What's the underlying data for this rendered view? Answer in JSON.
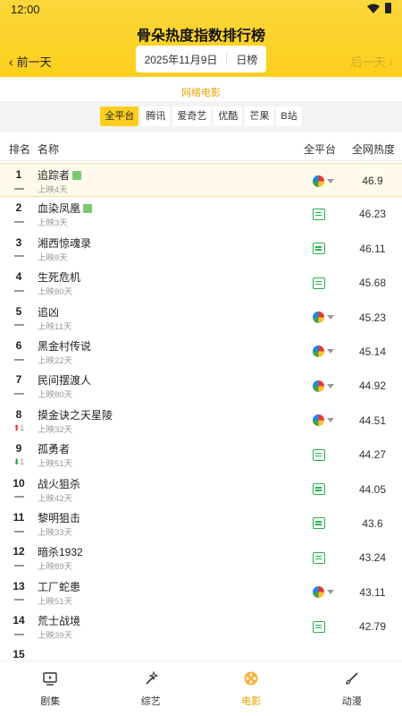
{
  "status": {
    "time": "12:00"
  },
  "header": {
    "title": "骨朵热度指数排行榜",
    "prev_label": "前一天",
    "next_label": "后一天",
    "date": "2025年11月9日",
    "period": "日榜"
  },
  "subtitle": "网络电影",
  "platforms": [
    "全平台",
    "腾讯",
    "爱奇艺",
    "优酷",
    "芒果",
    "B站"
  ],
  "columns": {
    "rank": "排名",
    "name": "名称",
    "platform": "全平台",
    "heat": "全网热度"
  },
  "rows": [
    {
      "rank": "1",
      "trend": "",
      "title": "追踪者",
      "badge": true,
      "days": "上映4天",
      "platform": "multi",
      "heat": "46.9"
    },
    {
      "rank": "2",
      "trend": "",
      "title": "血染凤凰",
      "badge": true,
      "days": "上映3天",
      "platform": "iqiyi",
      "heat": "46.23"
    },
    {
      "rank": "3",
      "trend": "",
      "title": "湘西惊魂录",
      "badge": false,
      "days": "上映8天",
      "platform": "iqiyi",
      "heat": "46.11"
    },
    {
      "rank": "4",
      "trend": "",
      "title": "生死危机",
      "badge": false,
      "days": "上映80天",
      "platform": "iqiyi",
      "heat": "45.68"
    },
    {
      "rank": "5",
      "trend": "",
      "title": "追凶",
      "badge": false,
      "days": "上映11天",
      "platform": "multi",
      "heat": "45.23"
    },
    {
      "rank": "6",
      "trend": "",
      "title": "黑金村传说",
      "badge": false,
      "days": "上映22天",
      "platform": "multi",
      "heat": "45.14"
    },
    {
      "rank": "7",
      "trend": "",
      "title": "民间摆渡人",
      "badge": false,
      "days": "上映80天",
      "platform": "multi",
      "heat": "44.92"
    },
    {
      "rank": "8",
      "trend": "up",
      "trend_value": "1",
      "title": "摸金诀之天星陵",
      "badge": false,
      "days": "上映32天",
      "platform": "multi",
      "heat": "44.51"
    },
    {
      "rank": "9",
      "trend": "down",
      "trend_value": "1",
      "title": "孤勇者",
      "badge": false,
      "days": "上映51天",
      "platform": "iqiyi",
      "heat": "44.27"
    },
    {
      "rank": "10",
      "trend": "",
      "title": "战火狙杀",
      "badge": false,
      "days": "上映42天",
      "platform": "iqiyi",
      "heat": "44.05"
    },
    {
      "rank": "11",
      "trend": "",
      "title": "黎明狙击",
      "badge": false,
      "days": "上映33天",
      "platform": "iqiyi",
      "heat": "43.6"
    },
    {
      "rank": "12",
      "trend": "",
      "title": "暗杀1932",
      "badge": false,
      "days": "上映89天",
      "platform": "iqiyi",
      "heat": "43.24"
    },
    {
      "rank": "13",
      "trend": "",
      "title": "工厂蛇患",
      "badge": false,
      "days": "上映51天",
      "platform": "multi",
      "heat": "43.11"
    },
    {
      "rank": "14",
      "trend": "",
      "title": "荒士战境",
      "badge": false,
      "days": "上映39天",
      "platform": "iqiyi",
      "heat": "42.79"
    },
    {
      "rank": "15",
      "trend": "",
      "title": "",
      "badge": false,
      "days": "",
      "platform": "",
      "heat": ""
    }
  ],
  "bottom_nav": [
    {
      "label": "剧集",
      "icon": "tv-icon",
      "active": false
    },
    {
      "label": "综艺",
      "icon": "magic-wand-icon",
      "active": false
    },
    {
      "label": "电影",
      "icon": "film-reel-icon",
      "active": true
    },
    {
      "label": "动漫",
      "icon": "brush-icon",
      "active": false
    }
  ],
  "colors": {
    "accent": "#fccf1c",
    "active_text": "#e8a200",
    "rise": "#e53935",
    "fall": "#2e9e44"
  }
}
